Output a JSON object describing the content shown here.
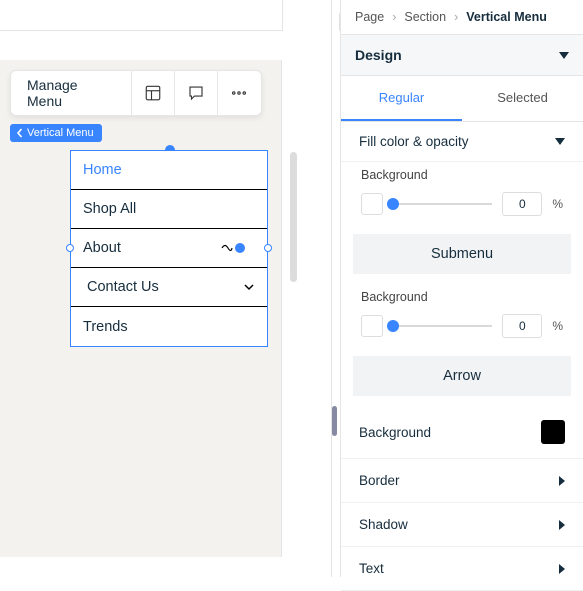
{
  "toolbar": {
    "manage_label": "Manage Menu"
  },
  "badge": {
    "label": "Vertical Menu"
  },
  "menu": {
    "items": [
      {
        "label": "Home"
      },
      {
        "label": "Shop All"
      },
      {
        "label": "About"
      },
      {
        "label": "Trends"
      }
    ],
    "submenu": {
      "label": "Contact Us"
    }
  },
  "breadcrumb": {
    "a": "Page",
    "b": "Section",
    "c": "Vertical Menu"
  },
  "panel": {
    "design_label": "Design",
    "tabs": {
      "regular": "Regular",
      "selected": "Selected"
    },
    "fill_label": "Fill color & opacity",
    "background_label": "Background",
    "bg1_value": "0",
    "bg1_unit": "%",
    "submenu_title": "Submenu",
    "bg2_value": "0",
    "bg2_unit": "%",
    "arrow_title": "Arrow",
    "arrow_bg_label": "Background",
    "arrow_bg_color": "#000000",
    "border_label": "Border",
    "shadow_label": "Shadow",
    "text_label": "Text"
  }
}
